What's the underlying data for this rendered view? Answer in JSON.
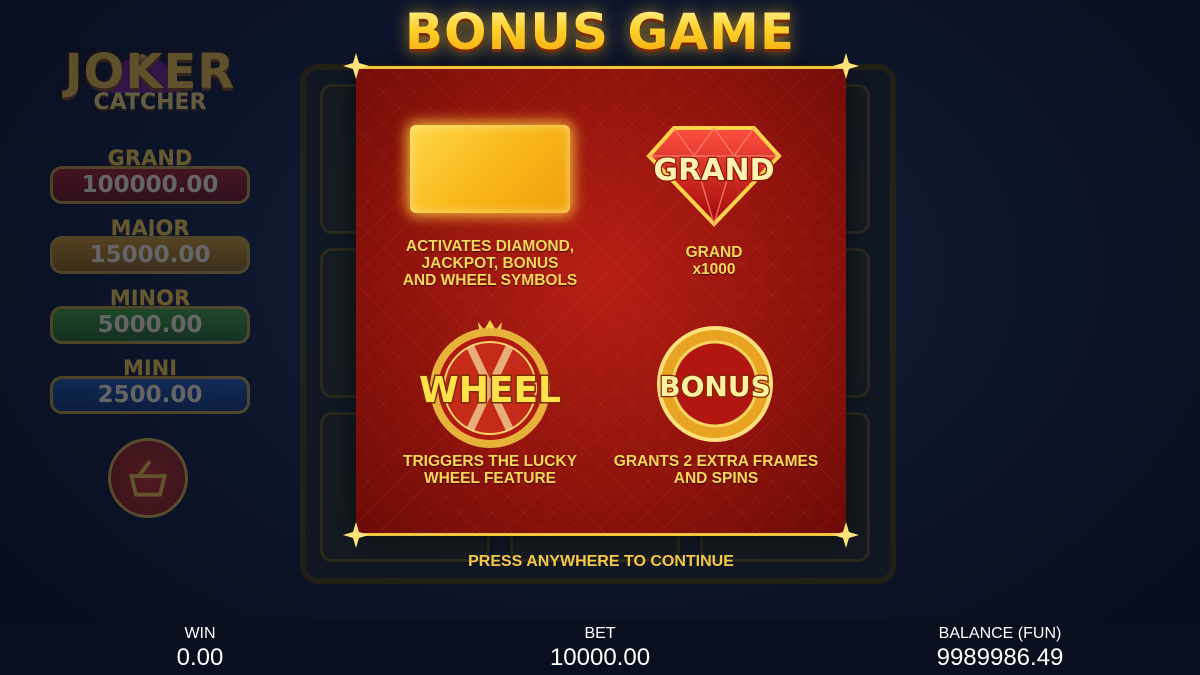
{
  "title": "BONUS GAME",
  "logo": {
    "line1": "JOKER",
    "line2": "CATCHER"
  },
  "jackpots": [
    {
      "name": "GRAND",
      "value": "100000.00"
    },
    {
      "name": "MAJOR",
      "value": "15000.00"
    },
    {
      "name": "MINOR",
      "value": "5000.00"
    },
    {
      "name": "MINI",
      "value": "2500.00"
    }
  ],
  "symbols": [
    {
      "icon": "gold-frame-icon",
      "label": "",
      "description": "ACTIVATES DIAMOND,\nJACKPOT, BONUS\nAND WHEEL SYMBOLS"
    },
    {
      "icon": "grand-diamond-icon",
      "label": "GRAND",
      "description": "GRAND\nx1000"
    },
    {
      "icon": "wheel-icon",
      "label": "WHEEL",
      "description": "TRIGGERS THE LUCKY\nWHEEL FEATURE"
    },
    {
      "icon": "bonus-coin-icon",
      "label": "BONUS",
      "description": "GRANTS 2 EXTRA FRAMES\nAND SPINS"
    }
  ],
  "continue_text": "PRESS ANYWHERE TO CONTINUE",
  "status": {
    "win_label": "WIN",
    "win_value": "0.00",
    "bet_label": "BET",
    "bet_value": "10000.00",
    "balance_label": "BALANCE (FUN)",
    "balance_value": "9989986.49"
  },
  "colors": {
    "modal_red": "#a8190f",
    "gold": "#f3c43e",
    "text_gold": "#fbd85a",
    "background": "#0c1429"
  }
}
